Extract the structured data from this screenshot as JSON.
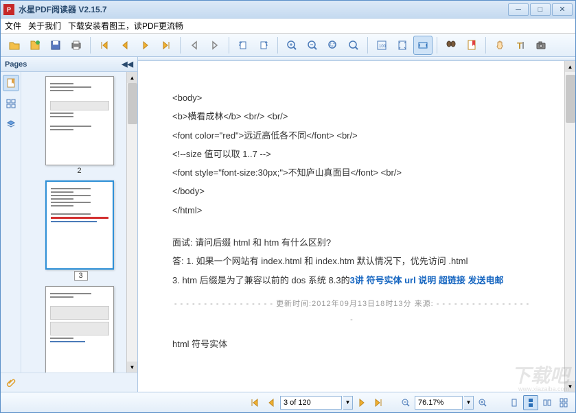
{
  "app": {
    "title": "水星PDF阅读器  V2.15.7"
  },
  "menu": {
    "file": "文件",
    "about": "关于我们",
    "promo": "下载安装看图王，读PDF更流畅"
  },
  "sidebar": {
    "title": "Pages",
    "thumbs": [
      {
        "num": "2"
      },
      {
        "num": "3"
      },
      {
        "num": ""
      }
    ]
  },
  "doc": {
    "l1": "<body>",
    "l2": "<b>横看成林</b> <br/> <br/>",
    "l3": "<font color=\"red\">远近高低各不同</font> <br/>",
    "l4": "<!--size 值可以取 1..7 -->",
    "l5": "<font style=\"font-size:30px;\">不知庐山真面目</font> <br/>",
    "l6": "</body>",
    "l7": "</html>",
    "q": "面试: 请问后缀 html 和 htm 有什么区别?",
    "a1": "答: 1. 如果一个网站有 index.html 和 index.htm 默认情况下，优先访问 .html",
    "a2_pre": "    3. htm 后缀是为了兼容以前的 dos 系统 8.3的",
    "a2_blue": "3讲 符号实体 url 说明 超链接 发送电邮",
    "meta": "更新时间:2012年09月13日18时13分 来源:",
    "last": "html 符号实体"
  },
  "status": {
    "page": "3 of 120",
    "zoom": "76.17%"
  },
  "watermark": {
    "main": "下载吧",
    "sub": "www.xiazaiba.com"
  }
}
